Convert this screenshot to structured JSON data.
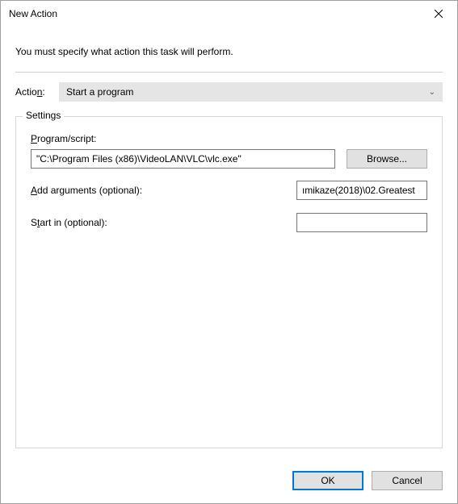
{
  "window": {
    "title": "New Action"
  },
  "instruction": "You must specify what action this task will perform.",
  "action": {
    "label": "Action:",
    "selected": "Start a program"
  },
  "settings": {
    "title": "Settings",
    "program_label_pre": "P",
    "program_label_post": "rogram/script:",
    "program_value": "\"C:\\Program Files (x86)\\VideoLAN\\VLC\\vlc.exe\"",
    "browse_label": "Browse...",
    "args_label_pre": "A",
    "args_label_post": "dd arguments (optional):",
    "args_value": "ımikaze(2018)\\02.Greatest",
    "startin_label_pre": "S",
    "startin_label_post": "tart in (optional):",
    "startin_value": ""
  },
  "buttons": {
    "ok": "OK",
    "cancel": "Cancel"
  }
}
